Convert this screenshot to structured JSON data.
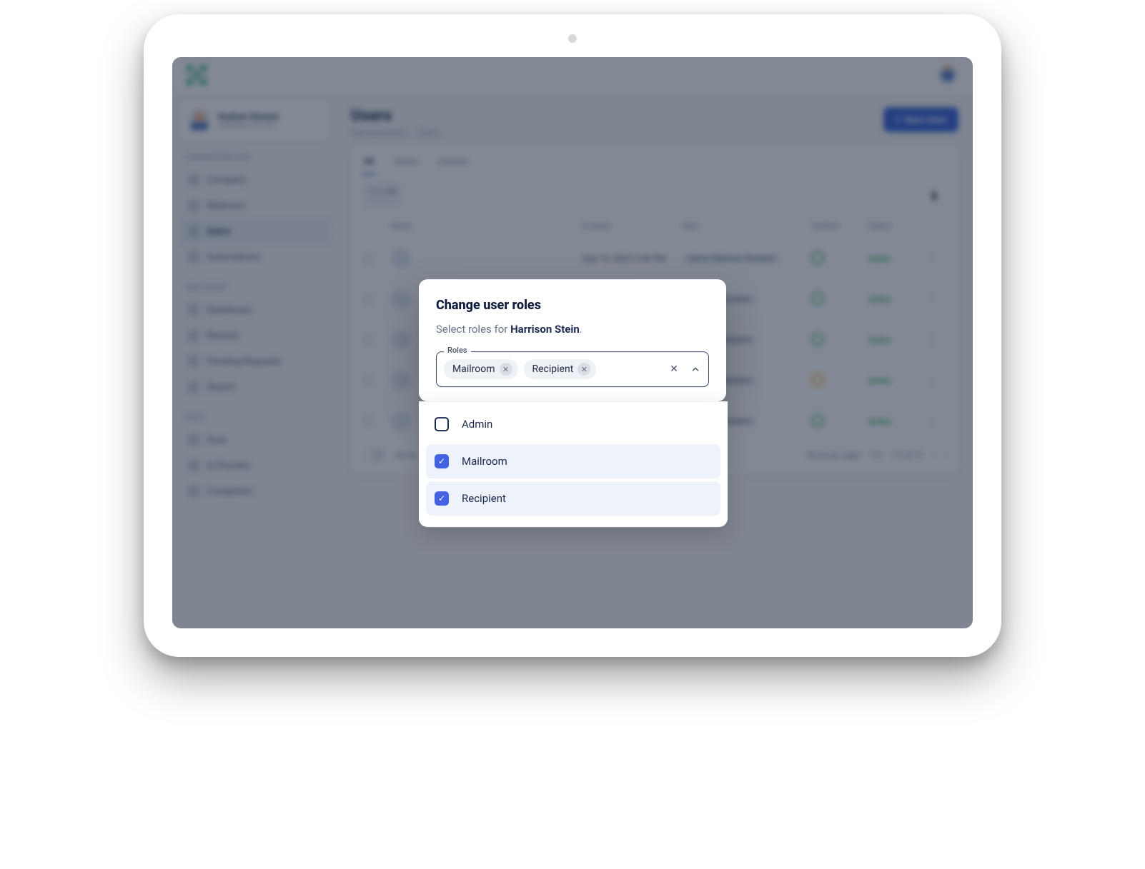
{
  "topbar": {
    "avatar_alt": "Account"
  },
  "user_card": {
    "name": "Hudson Alvarez",
    "email": "alvabharmons.net"
  },
  "sidebar": {
    "section_admin": "ADMINISTRATION",
    "section_mailroom": "MAILROOM",
    "section_hist": "HIST.",
    "items": {
      "company": "Company",
      "mailroom": "Mailroom",
      "users": "Users",
      "automations": "Automations",
      "dashboard": "Dashboard",
      "receive": "Receive",
      "pending": "Pending Requests",
      "search": "Search",
      "scan": "Scan",
      "inprocess": "In Process",
      "completed": "Completed"
    }
  },
  "page": {
    "title": "Users",
    "crumb1": "Administration",
    "crumb2": "Users",
    "new_user": "New User"
  },
  "tabs": {
    "all": "All",
    "active": "Active",
    "inactive": "Inactive"
  },
  "filter": {
    "role_label": "Role",
    "role_value": "All"
  },
  "table": {
    "h_name": "Name",
    "h_created": "Created",
    "h_role": "Role",
    "h_verified": "Verified",
    "h_status": "Status",
    "status_active": "Active",
    "role_admin": "Admin, Mailroom, Recipient",
    "role_recip": "Mailroom, Recipient",
    "created_sample": "Sep 16, 2023 2:46 PM"
  },
  "pager": {
    "dense": "Dense",
    "rpp": "Rows per page:",
    "rpp_val": "5",
    "range": "1-5 of 19"
  },
  "modal": {
    "title": "Change user roles",
    "sub_prefix": "Select roles for ",
    "sub_name": "Harrison Stein",
    "sub_suffix": ".",
    "field_label": "Roles",
    "chips": {
      "mailroom": "Mailroom",
      "recipient": "Recipient"
    },
    "options": {
      "admin": "Admin",
      "mailroom": "Mailroom",
      "recipient": "Recipient"
    }
  }
}
